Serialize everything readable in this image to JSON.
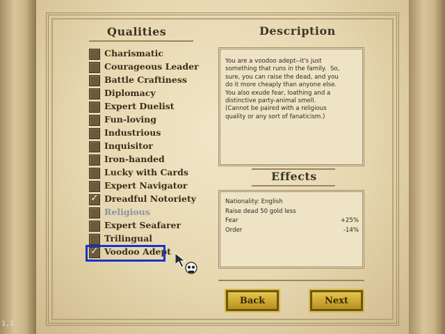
{
  "titles": {
    "qualities": "Qualities",
    "description": "Description",
    "effects": "Effects"
  },
  "qualities": [
    {
      "label": "Charismatic",
      "checked": false,
      "disabled": false
    },
    {
      "label": "Courageous Leader",
      "checked": false,
      "disabled": false
    },
    {
      "label": "Battle Craftiness",
      "checked": false,
      "disabled": false
    },
    {
      "label": "Diplomacy",
      "checked": false,
      "disabled": false
    },
    {
      "label": "Expert Duelist",
      "checked": false,
      "disabled": false
    },
    {
      "label": "Fun-loving",
      "checked": false,
      "disabled": false
    },
    {
      "label": "Industrious",
      "checked": false,
      "disabled": false
    },
    {
      "label": "Inquisitor",
      "checked": false,
      "disabled": false
    },
    {
      "label": "Iron-handed",
      "checked": false,
      "disabled": false
    },
    {
      "label": "Lucky with Cards",
      "checked": false,
      "disabled": false
    },
    {
      "label": "Expert Navigator",
      "checked": false,
      "disabled": false
    },
    {
      "label": "Dreadful Notoriety",
      "checked": true,
      "disabled": false
    },
    {
      "label": "Religious",
      "checked": false,
      "disabled": true
    },
    {
      "label": "Expert Seafarer",
      "checked": false,
      "disabled": false
    },
    {
      "label": "Trilingual",
      "checked": false,
      "disabled": false
    },
    {
      "label": "Voodoo Adept",
      "checked": true,
      "disabled": false,
      "selected": true
    }
  ],
  "description": "You are a voodoo adept--it's just\nsomething that runs in the family.  So,\nsure, you can raise the dead, and you\ndo it more cheaply than anyone else.\nYou also exude fear, loathing and a\ndistinctive party-animal smell.\n(Cannot be paired with a religious\nquality or any sort of fanaticism.)",
  "effects": [
    {
      "label": "Nationality: English",
      "value": ""
    },
    {
      "label": "Raise dead 50 gold less",
      "value": ""
    },
    {
      "label": "Fear",
      "value": "+25%"
    },
    {
      "label": "Order",
      "value": "-14%"
    }
  ],
  "buttons": {
    "back": "Back",
    "next": "Next"
  },
  "coordinates_display": "1,1",
  "colors": {
    "selection_outline": "#1534c8",
    "button_gold": "#d9b93c",
    "disabled_text": "#8a94a4"
  }
}
